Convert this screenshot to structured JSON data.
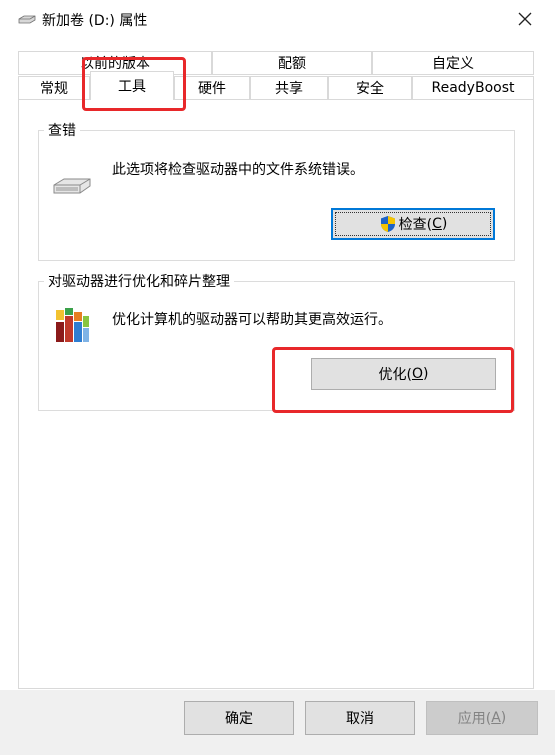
{
  "window": {
    "title": "新加卷 (D:) 属性"
  },
  "tabs_back": [
    {
      "label": "以前的版本"
    },
    {
      "label": "配额"
    },
    {
      "label": "自定义"
    }
  ],
  "tabs_front": [
    {
      "label": "常规"
    },
    {
      "label": "工具"
    },
    {
      "label": "硬件"
    },
    {
      "label": "共享"
    },
    {
      "label": "安全"
    },
    {
      "label": "ReadyBoost"
    }
  ],
  "error_check": {
    "group_label": "查错",
    "description": "此选项将检查驱动器中的文件系统错误。",
    "button_text": "检查(",
    "button_key": "C",
    "button_close": ")"
  },
  "optimize": {
    "group_label": "对驱动器进行优化和碎片整理",
    "description": "优化计算机的驱动器可以帮助其更高效运行。",
    "button_text": "优化(",
    "button_key": "O",
    "button_close": ")"
  },
  "footer": {
    "ok": "确定",
    "cancel": "取消",
    "apply_text": "应用(",
    "apply_key": "A",
    "apply_close": ")"
  },
  "colors": {
    "highlight": "#e8282a",
    "default_button_border": "#0078d7",
    "button_bg": "#e1e1e1"
  }
}
